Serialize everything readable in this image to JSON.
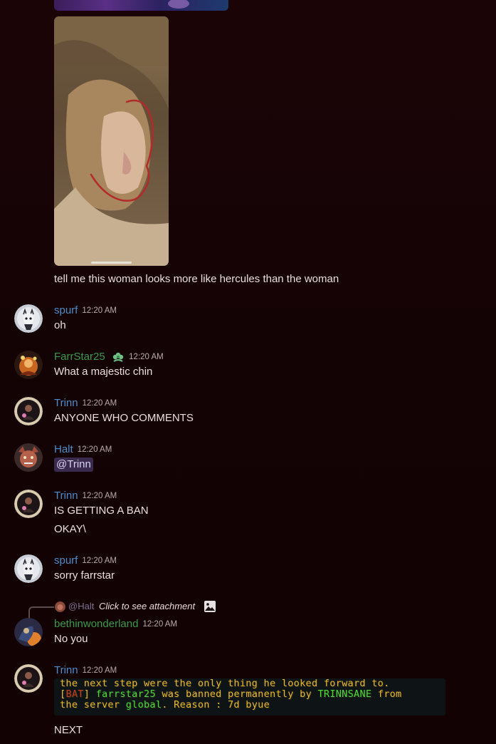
{
  "messages": {
    "caption": "tell me this woman looks more like hercules than the woman",
    "m1": {
      "user": "spurf",
      "time": "12:20 AM",
      "text": "oh"
    },
    "m2": {
      "user": "FarrStar25",
      "time": "12:20 AM",
      "text": "What a majestic chin"
    },
    "m3": {
      "user": "Trinn",
      "time": "12:20 AM",
      "text": "ANYONE WHO COMMENTS"
    },
    "m4": {
      "user": "Halt",
      "time": "12:20 AM",
      "mention": "@Trinn"
    },
    "m5": {
      "user": "Trinn",
      "time": "12:20 AM",
      "text": "IS GETTING A BAN",
      "text2": "OKAY\\"
    },
    "m6": {
      "user": "spurf",
      "time": "12:20 AM",
      "text": "sorry farrstar"
    },
    "m7": {
      "reply_user": "@Halt",
      "reply_text": "Click to see attachment",
      "user": "bethinwonderland",
      "time": "12:20 AM",
      "text": "No you"
    },
    "m8": {
      "user": "Trinn",
      "time": "12:20 AM",
      "embed": {
        "line1": "the next step were the only thing he looked forward to.",
        "line2_bracket_open": "[",
        "line2_tag": "BAT",
        "line2_bracket_close": "]",
        "line2_user": "farrstar25",
        "line2_mid": "was banned permanently by",
        "line2_mod": "TRINNSANE",
        "line2_from": "from",
        "line3_a": "the server",
        "line3_server": "global",
        "line3_b": ". Reason : 7d byue"
      },
      "text": "NEXT"
    }
  },
  "colors": {
    "background": "#140305",
    "username_blue": "#4f8cc9",
    "username_green": "#3c9a4a",
    "mention_bg": "#3a2a4e"
  }
}
